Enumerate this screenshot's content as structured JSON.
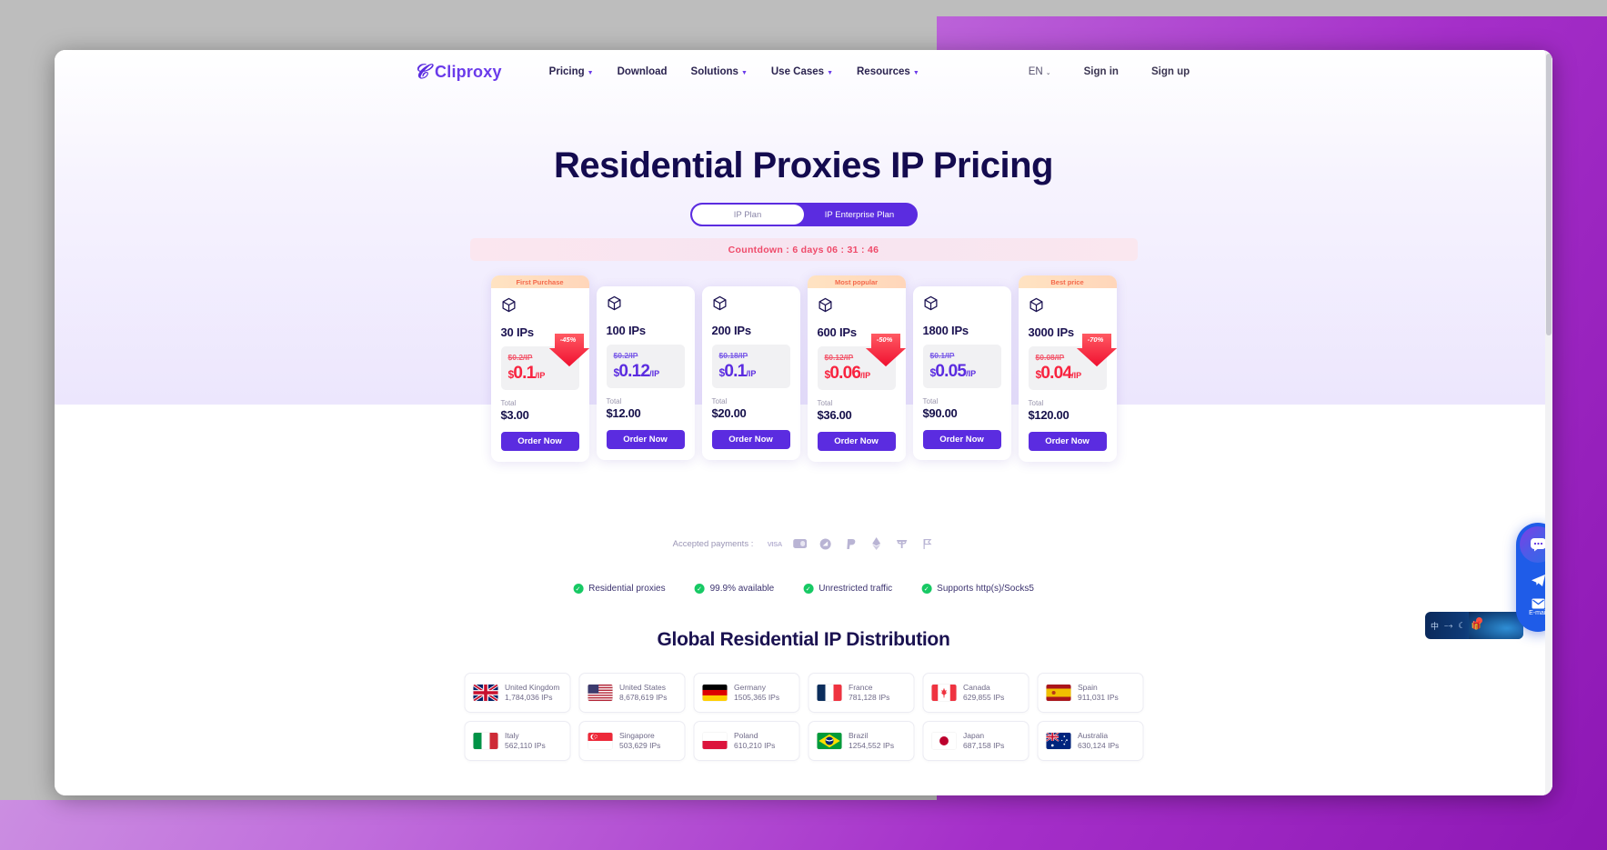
{
  "nav": {
    "logo_text": "Cliproxy",
    "logo_icon": "c-swirl-logo-icon",
    "links": [
      {
        "label": "Pricing",
        "has_caret": true
      },
      {
        "label": "Download",
        "has_caret": false
      },
      {
        "label": "Solutions",
        "has_caret": true
      },
      {
        "label": "Use Cases",
        "has_caret": true
      },
      {
        "label": "Resources",
        "has_caret": true
      }
    ],
    "language": "EN",
    "sign_in": "Sign in",
    "sign_up": "Sign up"
  },
  "hero": {
    "title": "Residential Proxies IP Pricing",
    "toggle": {
      "option_active": "IP Plan",
      "option_inactive": "IP Enterprise Plan"
    },
    "countdown": "Countdown :  6  days 06 : 31 : 46"
  },
  "plans": [
    {
      "ribbon": "First Purchase",
      "ips": "30 IPs",
      "old_price": "$0.2/IP",
      "price_dollar": "$",
      "price_amount": "0.1",
      "price_unit": "/IP",
      "discount": "-45%",
      "highlight": true,
      "total_label": "Total",
      "total_value": "$3.00",
      "cta": "Order Now"
    },
    {
      "ribbon": "",
      "ips": "100 IPs",
      "old_price": "$0.2/IP",
      "price_dollar": "$",
      "price_amount": "0.12",
      "price_unit": "/IP",
      "discount": "",
      "highlight": false,
      "total_label": "Total",
      "total_value": "$12.00",
      "cta": "Order Now"
    },
    {
      "ribbon": "",
      "ips": "200 IPs",
      "old_price": "$0.18/IP",
      "price_dollar": "$",
      "price_amount": "0.1",
      "price_unit": "/IP",
      "discount": "",
      "highlight": false,
      "total_label": "Total",
      "total_value": "$20.00",
      "cta": "Order Now"
    },
    {
      "ribbon": "Most popular",
      "ips": "600 IPs",
      "old_price": "$0.12/IP",
      "price_dollar": "$",
      "price_amount": "0.06",
      "price_unit": "/IP",
      "discount": "-50%",
      "highlight": true,
      "total_label": "Total",
      "total_value": "$36.00",
      "cta": "Order Now"
    },
    {
      "ribbon": "",
      "ips": "1800 IPs",
      "old_price": "$0.1/IP",
      "price_dollar": "$",
      "price_amount": "0.05",
      "price_unit": "/IP",
      "discount": "",
      "highlight": false,
      "total_label": "Total",
      "total_value": "$90.00",
      "cta": "Order Now"
    },
    {
      "ribbon": "Best price",
      "ips": "3000 IPs",
      "old_price": "$0.08/IP",
      "price_dollar": "$",
      "price_amount": "0.04",
      "price_unit": "/IP",
      "discount": "-70%",
      "highlight": true,
      "total_label": "Total",
      "total_value": "$120.00",
      "cta": "Order Now"
    }
  ],
  "payments": {
    "label": "Accepted payments :",
    "icons": [
      "visa-icon",
      "card-icon",
      "crypto-coin-icon",
      "paypal-icon",
      "ethereum-icon",
      "tether-icon",
      "flag-coin-icon"
    ]
  },
  "features": [
    "Residential proxies",
    "99.9% available",
    "Unrestricted traffic",
    "Supports http(s)/Socks5"
  ],
  "distribution": {
    "title": "Global Residential IP Distribution",
    "countries": [
      {
        "name": "United Kingdom",
        "ips": "1,784,036 IPs",
        "flag": "uk-flag-icon"
      },
      {
        "name": "United States",
        "ips": "8,678,619 IPs",
        "flag": "us-flag-icon"
      },
      {
        "name": "Germany",
        "ips": "1505,365 IPs",
        "flag": "de-flag-icon"
      },
      {
        "name": "France",
        "ips": "781,128 IPs",
        "flag": "fr-flag-icon"
      },
      {
        "name": "Canada",
        "ips": "629,855 IPs",
        "flag": "ca-flag-icon"
      },
      {
        "name": "Spain",
        "ips": "911,031 IPs",
        "flag": "es-flag-icon"
      },
      {
        "name": "Italy",
        "ips": "562,110 IPs",
        "flag": "it-flag-icon"
      },
      {
        "name": "Singapore",
        "ips": "503,629 IPs",
        "flag": "sg-flag-icon"
      },
      {
        "name": "Poland",
        "ips": "610,210 IPs",
        "flag": "pl-flag-icon"
      },
      {
        "name": "Brazil",
        "ips": "1254,552 IPs",
        "flag": "br-flag-icon"
      },
      {
        "name": "Japan",
        "ips": "687,158 IPs",
        "flag": "jp-flag-icon"
      },
      {
        "name": "Australia",
        "ips": "630,124 IPs",
        "flag": "au-flag-icon"
      }
    ]
  },
  "float_widget": {
    "chat_icon": "chat-bubble-icon",
    "telegram_icon": "telegram-icon",
    "email_icon": "envelope-icon",
    "email_label": "E-mail"
  },
  "colors": {
    "brand_purple": "#5b2ce0",
    "title_navy": "#140b4f",
    "discount_red": "#f8233f",
    "countdown_pink": "#ef4a6a",
    "check_green": "#17c964"
  }
}
